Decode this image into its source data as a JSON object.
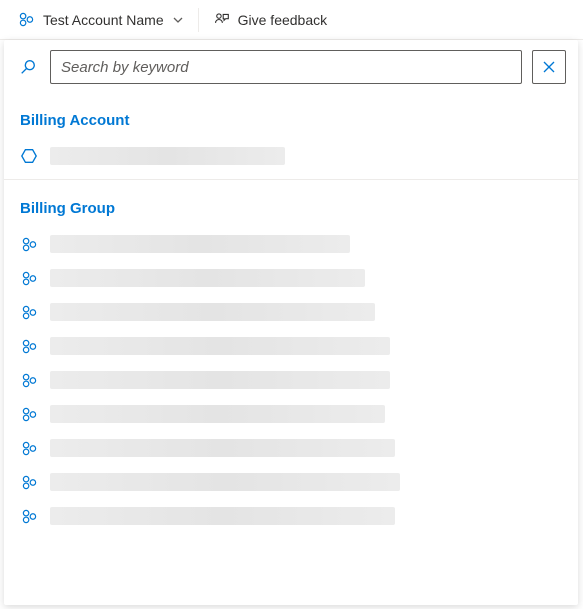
{
  "topbar": {
    "scope_label": "Test Account Name",
    "feedback_label": "Give feedback"
  },
  "search": {
    "placeholder": "Search by keyword"
  },
  "sections": {
    "billing_account": {
      "title": "Billing Account",
      "items": [
        {
          "redacted_width": 235
        }
      ]
    },
    "billing_group": {
      "title": "Billing Group",
      "items": [
        {
          "redacted_width": 300
        },
        {
          "redacted_width": 315
        },
        {
          "redacted_width": 325
        },
        {
          "redacted_width": 340
        },
        {
          "redacted_width": 340
        },
        {
          "redacted_width": 335
        },
        {
          "redacted_width": 345
        },
        {
          "redacted_width": 350
        },
        {
          "redacted_width": 345
        }
      ]
    }
  },
  "colors": {
    "accent": "#0078d4"
  }
}
